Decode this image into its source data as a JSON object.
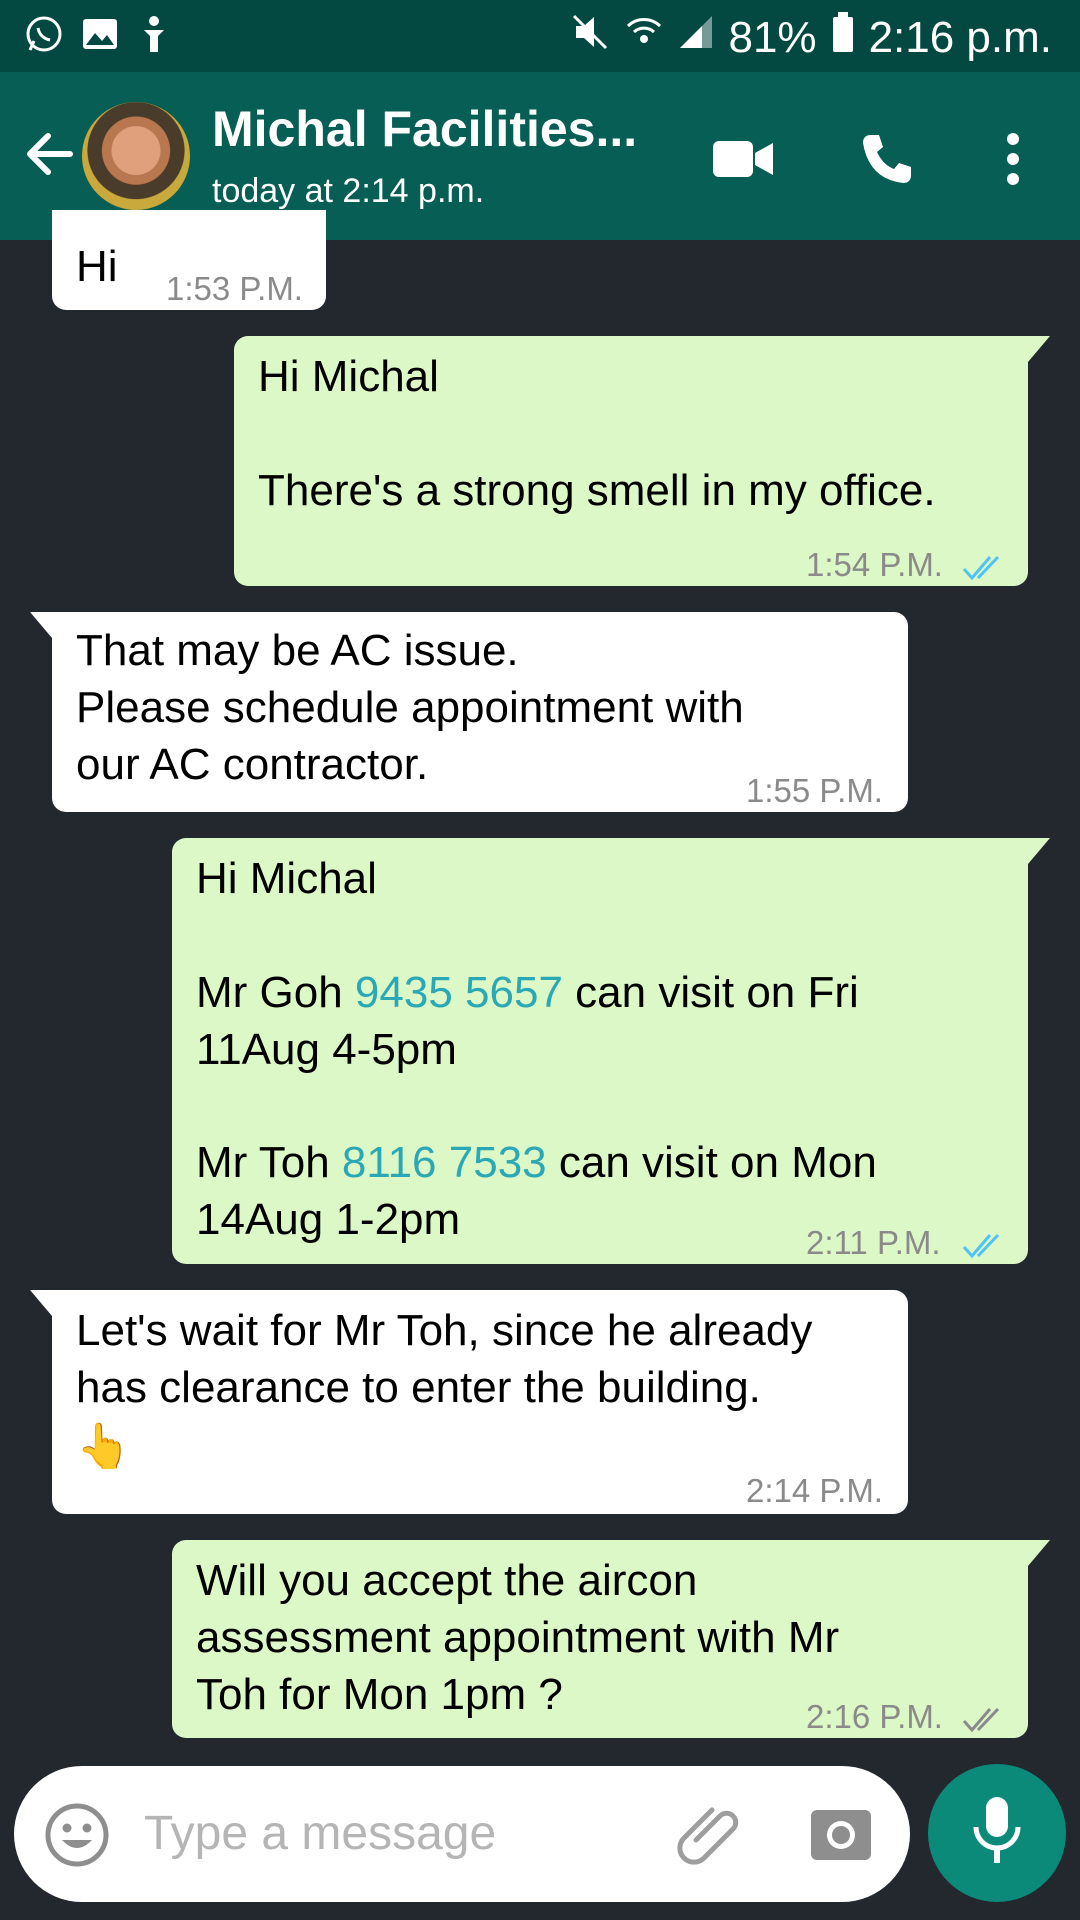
{
  "status_bar": {
    "battery": "81%",
    "time": "2:16 p.m."
  },
  "header": {
    "contact_name": "Michal Facilities...",
    "last_seen": "today at 2:14 p.m."
  },
  "messages": [
    {
      "direction": "incoming",
      "lines": [
        "Hi"
      ],
      "time": "1:53 P.M."
    },
    {
      "direction": "outgoing",
      "lines": [
        "Hi Michal",
        "",
        "There's a strong smell in my office."
      ],
      "time": "1:54 P.M.",
      "ticks": "read"
    },
    {
      "direction": "incoming",
      "lines": [
        "That may be AC issue.",
        "Please schedule appointment with",
        "our AC contractor."
      ],
      "time": "1:55 P.M."
    },
    {
      "direction": "outgoing",
      "time": "2:11 P.M.",
      "ticks": "read",
      "greeting": "Hi Michal",
      "p1_pre": "Mr Goh ",
      "p1_phone": "9435 5657",
      "p1_post": " can visit on Fri",
      "p1_line2": "11Aug 4-5pm",
      "p2_pre": "Mr Toh ",
      "p2_phone": "8116 7533",
      "p2_post": " can visit on Mon",
      "p2_line2": "14Aug 1-2pm"
    },
    {
      "direction": "incoming",
      "lines": [
        "Let's wait for Mr Toh, since he already",
        "has clearance to enter the building."
      ],
      "emoji": "👆",
      "time": "2:14 P.M."
    },
    {
      "direction": "outgoing",
      "lines": [
        "Will you accept the aircon",
        "assessment appointment with Mr",
        "Toh for Mon 1pm ?"
      ],
      "time": "2:16 P.M.",
      "ticks": "delivered"
    }
  ],
  "input": {
    "placeholder": "Type a message"
  },
  "icons": [
    "whatsapp-icon",
    "gallery-icon",
    "accessibility-icon",
    "mute-icon",
    "wifi-icon",
    "signal-icon",
    "battery-icon",
    "back-arrow-icon",
    "video-call-icon",
    "voice-call-icon",
    "more-options-icon",
    "emoji-icon",
    "attach-icon",
    "camera-icon",
    "mic-icon"
  ],
  "colors": {
    "header": "#075e54",
    "status_bar": "#044842",
    "outgoing_bubble": "#dcf8c6",
    "incoming_bubble": "#ffffff",
    "background": "#23272e",
    "read_ticks": "#4fc3f7",
    "link": "#2aa8b6",
    "mic_button": "#0b8a79"
  }
}
